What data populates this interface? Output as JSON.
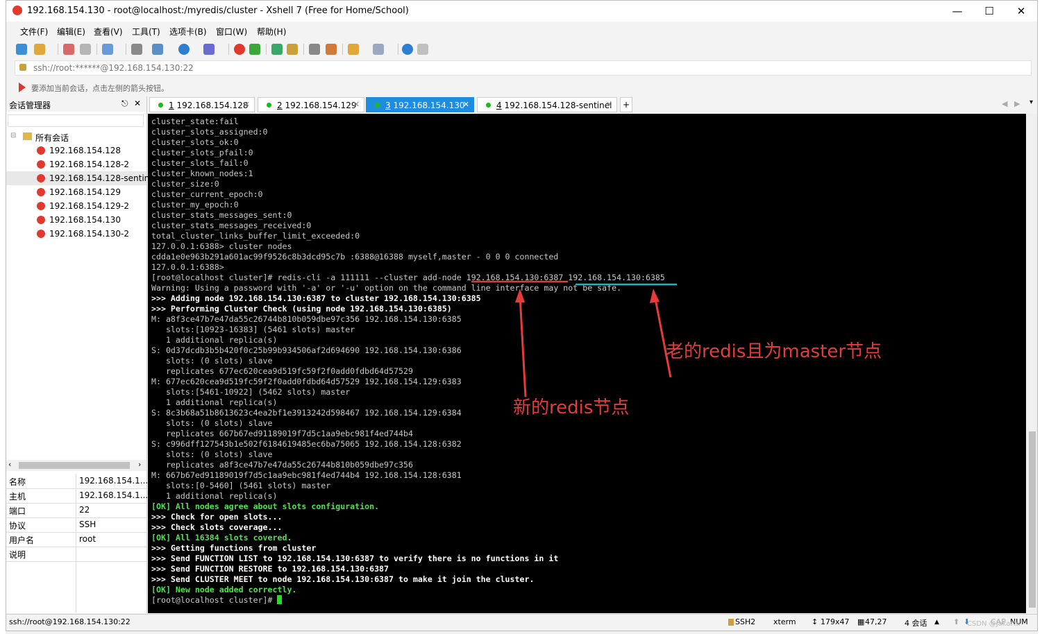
{
  "window": {
    "title": "192.168.154.130 - root@localhost:/myredis/cluster - Xshell 7 (Free for Home/School)"
  },
  "menu": [
    "文件(F)",
    "编辑(E)",
    "查看(V)",
    "工具(T)",
    "选项卡(B)",
    "窗口(W)",
    "帮助(H)"
  ],
  "address": "ssh://root:******@192.168.154.130:22",
  "hint": "要添加当前会话，点击左侧的箭头按钮。",
  "sidebar": {
    "title": "会话管理器",
    "root": "所有会话",
    "sessions": [
      "192.168.154.128",
      "192.168.154.128-2",
      "192.168.154.128-sentinel",
      "192.168.154.129",
      "192.168.154.129-2",
      "192.168.154.130",
      "192.168.154.130-2"
    ]
  },
  "props": [
    {
      "k": "名称",
      "v": "192.168.154.1..."
    },
    {
      "k": "主机",
      "v": "192.168.154.1..."
    },
    {
      "k": "端口",
      "v": "22"
    },
    {
      "k": "协议",
      "v": "SSH"
    },
    {
      "k": "用户名",
      "v": "root"
    },
    {
      "k": "说明",
      "v": ""
    }
  ],
  "tabs": [
    {
      "num": "1",
      "label": "192.168.154.128"
    },
    {
      "num": "2",
      "label": "192.168.154.129"
    },
    {
      "num": "3",
      "label": "192.168.154.130"
    },
    {
      "num": "4",
      "label": "192.168.154.128-sentinel"
    }
  ],
  "terminal": [
    {
      "t": "cluster_state:fail",
      "s": "n"
    },
    {
      "t": "cluster_slots_assigned:0",
      "s": "n"
    },
    {
      "t": "cluster_slots_ok:0",
      "s": "n"
    },
    {
      "t": "cluster_slots_pfail:0",
      "s": "n"
    },
    {
      "t": "cluster_slots_fail:0",
      "s": "n"
    },
    {
      "t": "cluster_known_nodes:1",
      "s": "n"
    },
    {
      "t": "cluster_size:0",
      "s": "n"
    },
    {
      "t": "cluster_current_epoch:0",
      "s": "n"
    },
    {
      "t": "cluster_my_epoch:0",
      "s": "n"
    },
    {
      "t": "cluster_stats_messages_sent:0",
      "s": "n"
    },
    {
      "t": "cluster_stats_messages_received:0",
      "s": "n"
    },
    {
      "t": "total_cluster_links_buffer_limit_exceeded:0",
      "s": "n"
    },
    {
      "t": "127.0.0.1:6388> cluster nodes",
      "s": "n"
    },
    {
      "t": "cdda1e0e963b291a601ac99f9526c8b3dcd95c7b :6388@16388 myself,master - 0 0 0 connected",
      "s": "n"
    },
    {
      "t": "127.0.0.1:6388>",
      "s": "n"
    },
    {
      "t": "[root@localhost cluster]# redis-cli -a 111111 --cluster add-node 192.168.154.130:6387 192.168.154.130:6385",
      "s": "n"
    },
    {
      "t": "Warning: Using a password with '-a' or '-u' option on the command line interface may not be safe.",
      "s": "n"
    },
    {
      "t": ">>> Adding node 192.168.154.130:6387 to cluster 192.168.154.130:6385",
      "s": "b"
    },
    {
      "t": ">>> Performing Cluster Check (using node 192.168.154.130:6385)",
      "s": "b"
    },
    {
      "t": "M: a8f3ce47b7e47da55c26744b810b059dbe97c356 192.168.154.130:6385",
      "s": "n"
    },
    {
      "t": "   slots:[10923-16383] (5461 slots) master",
      "s": "n"
    },
    {
      "t": "   1 additional replica(s)",
      "s": "n"
    },
    {
      "t": "S: 0d37dcdb3b5b420f0c25b99b934506af2d694690 192.168.154.130:6386",
      "s": "n"
    },
    {
      "t": "   slots: (0 slots) slave",
      "s": "n"
    },
    {
      "t": "   replicates 677ec620cea9d519fc59f2f0add0fdbd64d57529",
      "s": "n"
    },
    {
      "t": "M: 677ec620cea9d519fc59f2f0add0fdbd64d57529 192.168.154.129:6383",
      "s": "n"
    },
    {
      "t": "   slots:[5461-10922] (5462 slots) master",
      "s": "n"
    },
    {
      "t": "   1 additional replica(s)",
      "s": "n"
    },
    {
      "t": "S: 8c3b68a51b8613623c4ea2bf1e3913242d598467 192.168.154.129:6384",
      "s": "n"
    },
    {
      "t": "   slots: (0 slots) slave",
      "s": "n"
    },
    {
      "t": "   replicates 667b67ed91189019f7d5c1aa9ebc981f4ed744b4",
      "s": "n"
    },
    {
      "t": "S: c996dff127543b1e502f6184619485ec6ba75065 192.168.154.128:6382",
      "s": "n"
    },
    {
      "t": "   slots: (0 slots) slave",
      "s": "n"
    },
    {
      "t": "   replicates a8f3ce47b7e47da55c26744b810b059dbe97c356",
      "s": "n"
    },
    {
      "t": "M: 667b67ed91189019f7d5c1aa9ebc981f4ed744b4 192.168.154.128:6381",
      "s": "n"
    },
    {
      "t": "   slots:[0-5460] (5461 slots) master",
      "s": "n"
    },
    {
      "t": "   1 additional replica(s)",
      "s": "n"
    },
    {
      "t": "[OK] All nodes agree about slots configuration.",
      "s": "g"
    },
    {
      "t": ">>> Check for open slots...",
      "s": "b"
    },
    {
      "t": ">>> Check slots coverage...",
      "s": "b"
    },
    {
      "t": "[OK] All 16384 slots covered.",
      "s": "g"
    },
    {
      "t": ">>> Getting functions from cluster",
      "s": "b"
    },
    {
      "t": ">>> Send FUNCTION LIST to 192.168.154.130:6387 to verify there is no functions in it",
      "s": "b"
    },
    {
      "t": ">>> Send FUNCTION RESTORE to 192.168.154.130:6387",
      "s": "b"
    },
    {
      "t": ">>> Send CLUSTER MEET to node 192.168.154.130:6387 to make it join the cluster.",
      "s": "b"
    },
    {
      "t": "[OK] New node added correctly.",
      "s": "g"
    },
    {
      "t": "[root@localhost cluster]# ",
      "s": "n"
    }
  ],
  "annotations": {
    "new_node": "新的redis节点",
    "old_master": "老的redis且为master节点"
  },
  "status": {
    "conn": "ssh://root@192.168.154.130:22",
    "proto": "SSH2",
    "term": "xterm",
    "size": "179x47",
    "pos": "47,27",
    "sessions": "4 会话",
    "caps": "CAP",
    "num": "NUM",
    "watermark": "CSDN @Jakarta"
  },
  "colors": {
    "accent": "#1e8de0",
    "annotation": "#e53b3b",
    "ok": "#52e052"
  }
}
